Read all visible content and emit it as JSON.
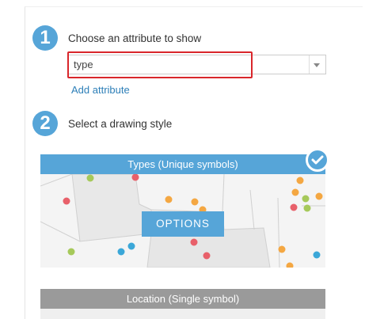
{
  "colors": {
    "accent": "#56a5d8",
    "link": "#2d7fb8",
    "highlight": "#d9262b",
    "secondary_header": "#9a9a9a"
  },
  "step1": {
    "number": "1",
    "label": "Choose an attribute to show",
    "select_value": "type",
    "add_link": "Add attribute"
  },
  "step2": {
    "number": "2",
    "label": "Select a drawing style"
  },
  "styles": [
    {
      "title": "Types (Unique symbols)",
      "selected": true,
      "options_label": "OPTIONS"
    },
    {
      "title": "Location (Single symbol)",
      "selected": false
    }
  ]
}
